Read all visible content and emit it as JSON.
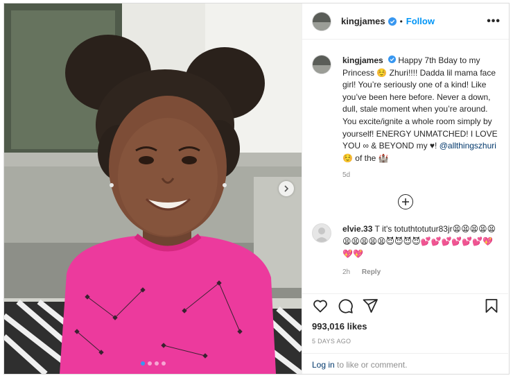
{
  "post": {
    "username": "kingjames",
    "separator": "•",
    "follow_label": "Follow",
    "more_label": "•••",
    "caption_username": "kingjames",
    "caption_part1": "Happy 7th Bday to my Princess ☺️ Zhuri!!!! Dadda lil mama face girl! You’re seriously one of a kind! Like you’ve been here before. Never a down, dull, stale moment when you’re around. You excite/ignite a whole room simply by yourself! ENERGY UNMATCHED! I LOVE YOU ∞ & BEYOND my ♥!",
    "caption_mention": "@allthingszhuri",
    "caption_part2": "☺️ of the 🏰",
    "caption_time": "5d",
    "likes": "993,016 likes",
    "date": "5 DAYS AGO",
    "login_link": "Log in",
    "login_rest": " to like or comment."
  },
  "comment": {
    "username": "elvie.33",
    "text": "T it's totuthtotutur83jr😫😫😫😫😫😫😫😫😫😫😈😈😈😈💕💕💕💕💕💕💖💖💖",
    "time": "2h",
    "reply_label": "Reply"
  },
  "carousel": {
    "slides": 4,
    "active_index": 0
  },
  "colors": {
    "accent": "#0095f6",
    "shirt": "#ec3a9d",
    "verified": "#3897f0"
  },
  "icons": [
    "verified-badge-icon",
    "chevron-right-icon",
    "plus-circle-icon",
    "heart-icon",
    "comment-icon",
    "share-icon",
    "bookmark-icon"
  ]
}
